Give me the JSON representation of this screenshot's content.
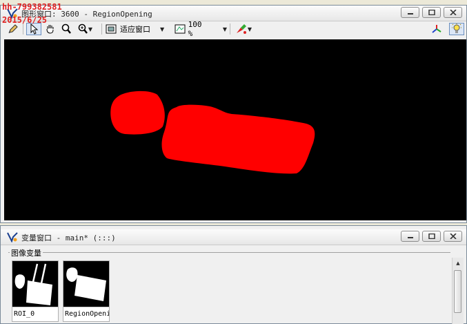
{
  "watermark": {
    "line1": "hh-799382581",
    "line2": "2015/6/25"
  },
  "graphics_window": {
    "title": "图形窗口: 3600 - RegionOpening",
    "toolbar": {
      "zoom_mode": "适应窗口",
      "zoom_percent": "100 %"
    },
    "canvas": {
      "background": "#000000",
      "region_color": "#ff0000"
    }
  },
  "variable_window": {
    "title": "变量窗口 - main* (:::)",
    "group_label": "图像变量",
    "thumbnails": [
      {
        "caption": "ROI_0"
      },
      {
        "caption": "RegionOpening"
      }
    ]
  }
}
